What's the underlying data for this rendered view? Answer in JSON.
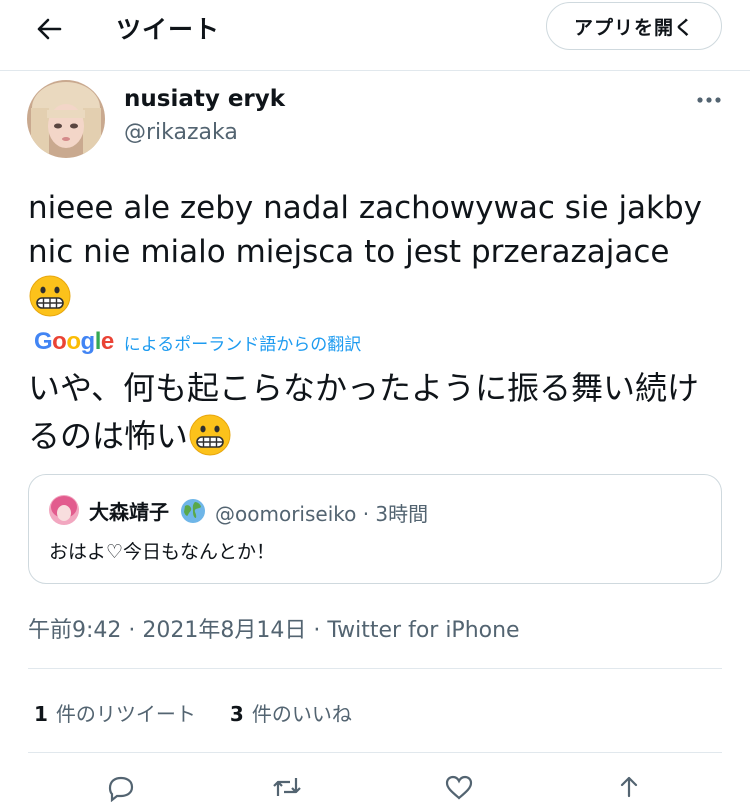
{
  "header": {
    "title": "ツイート",
    "open_app": "アプリを開く"
  },
  "author": {
    "name": "nusiaty eryk",
    "handle": "@rikazaka"
  },
  "tweet": {
    "text": "nieee ale zeby nadal zachowywac sie jakby nic nie mialo miejsca to jest przerazajace",
    "emoji": "grimacing-face",
    "translate_brand": "Google",
    "translate_label": "によるポーランド語からの翻訳",
    "translated_text": "いや、何も起こらなかったように振る舞い続けるのは怖い"
  },
  "quote": {
    "name": "大森靖子",
    "handle_time": "@oomoriseiko · 3時間",
    "text": "おはよ♡今日もなんとか！"
  },
  "meta": {
    "timestamp": "午前9:42 · 2021年8月14日 · Twitter for iPhone"
  },
  "stats": {
    "retweets_count": "1",
    "retweets_label": "件のリツイート",
    "likes_count": "3",
    "likes_label": "件のいいね"
  },
  "icons": [
    "back-arrow-icon",
    "more-icon",
    "grimacing-emoji-icon",
    "globe-icon",
    "reply-icon",
    "retweet-icon",
    "like-icon",
    "share-icon"
  ],
  "colors": {
    "accent": "#1d9bf0",
    "text": "#0f1419",
    "secondary": "#536471",
    "border": "#cfd9de"
  }
}
